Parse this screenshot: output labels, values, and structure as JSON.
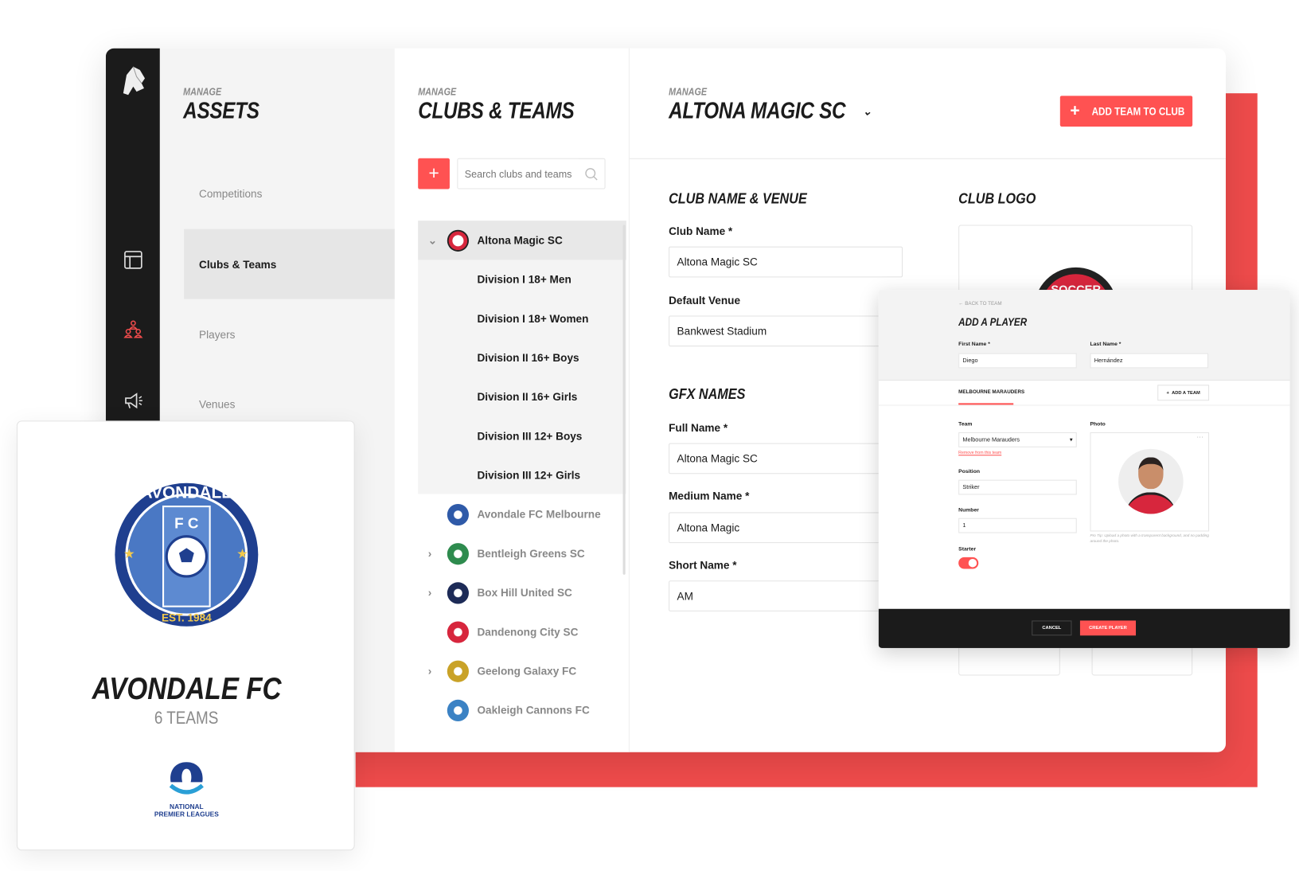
{
  "sidebar": {
    "icons": [
      "lion-logo-icon",
      "layout-icon",
      "users-icon",
      "megaphone-icon"
    ],
    "active_color": "#ee4b4b"
  },
  "assets": {
    "manage": "MANAGE",
    "title": "ASSETS",
    "items": [
      {
        "label": "Competitions"
      },
      {
        "label": "Clubs & Teams",
        "selected": true
      },
      {
        "label": "Players"
      },
      {
        "label": "Venues"
      }
    ]
  },
  "clubs": {
    "manage": "MANAGE",
    "title": "CLUBS & TEAMS",
    "add": "+",
    "search_placeholder": "Search clubs and teams",
    "expanded": {
      "name": "Altona Magic SC",
      "teams": [
        "Division I 18+ Men",
        "Division I 18+ Women",
        "Division II 16+ Boys",
        "Division II 16+ Girls",
        "Division III 12+ Boys",
        "Division III 12+ Girls"
      ]
    },
    "list": [
      {
        "name": "Avondale FC Melbourne",
        "expandable": false,
        "color": "#2f5aa8"
      },
      {
        "name": "Bentleigh Greens SC",
        "expandable": true,
        "color": "#2e8b4e"
      },
      {
        "name": "Box Hill United SC",
        "expandable": true,
        "color": "#1d2b57"
      },
      {
        "name": "Dandenong City SC",
        "expandable": false,
        "color": "#d7263d"
      },
      {
        "name": "Geelong Galaxy FC",
        "expandable": true,
        "color": "#c9a227"
      },
      {
        "name": "Oakleigh Cannons FC",
        "expandable": false,
        "color": "#3b82c4"
      }
    ]
  },
  "main": {
    "manage": "MANAGE",
    "title": "ALTONA MAGIC SC",
    "add_button": "ADD TEAM TO CLUB",
    "accent": "#ff5252",
    "section1": "CLUB NAME & VENUE",
    "club_name_label": "Club Name *",
    "club_name": "Altona Magic SC",
    "venue_label": "Default Venue",
    "venue": "Bankwest Stadium",
    "section2": "GFX NAMES",
    "full_label": "Full Name *",
    "full": "Altona Magic SC",
    "medium_label": "Medium Name *",
    "medium": "Altona Magic",
    "short_label": "Short Name *",
    "short": "AM",
    "logo_title": "CLUB LOGO",
    "logo_text": "SOCCER"
  },
  "modal": {
    "back": "BACK TO TEAM",
    "title": "ADD A PLAYER",
    "first_label": "First Name *",
    "first": "Diego",
    "last_label": "Last Name *",
    "last": "Hernández",
    "tab": "MELBOURNE MARAUDERS",
    "add_team": "ADD A TEAM",
    "team_label": "Team",
    "team": "Melbourne Marauders",
    "remove": "Remove from this team",
    "position_label": "Position",
    "position": "Striker",
    "number_label": "Number",
    "number": "1",
    "starter_label": "Starter",
    "starter": true,
    "photo_label": "Photo",
    "tip": "Pro Tip: Upload a photo with a transparent background, and no padding around the photo.",
    "cancel": "CANCEL",
    "create": "CREATE PLAYER"
  },
  "card": {
    "name": "AVONDALE FC",
    "teams": "6 TEAMS",
    "badge_top": "AVONDALE",
    "badge_mid": "F C",
    "badge_est": "EST. 1984",
    "league_line1": "NATIONAL",
    "league_line2": "PREMIER LEAGUES"
  }
}
